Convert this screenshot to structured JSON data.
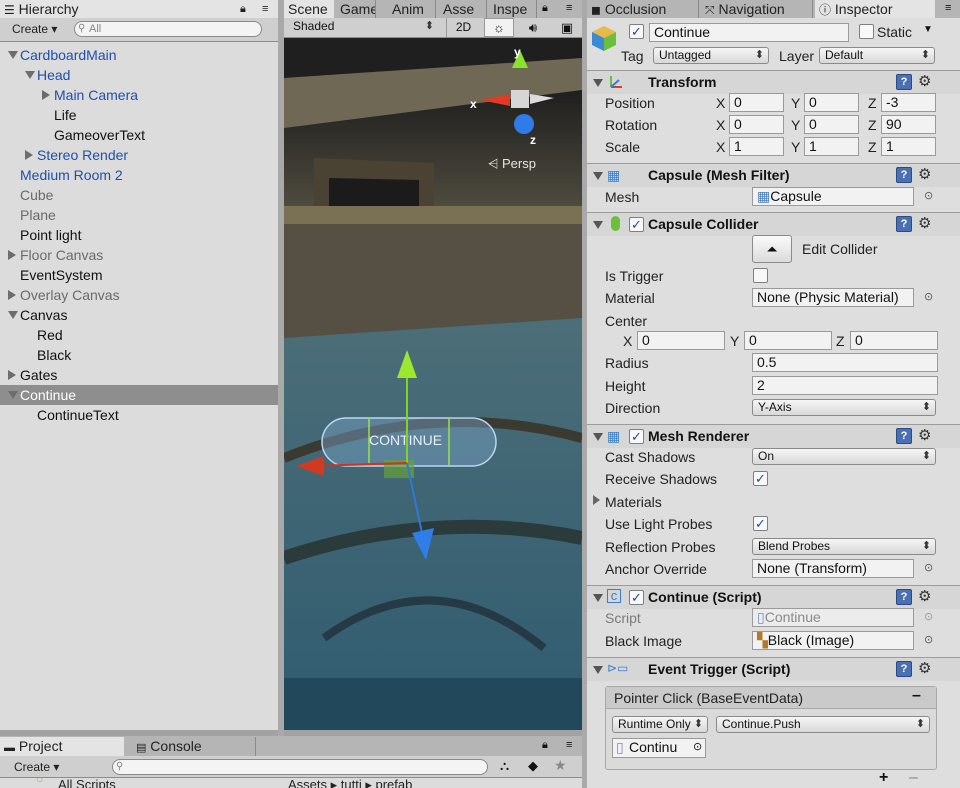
{
  "hierarchy": {
    "tab_label": "Hierarchy",
    "create_label": "Create ▾",
    "search_placeholder": "All",
    "items": [
      {
        "label": "CardboardMain",
        "indent": 0,
        "arrow": "down",
        "color": "blue"
      },
      {
        "label": "Head",
        "indent": 1,
        "arrow": "down",
        "color": "blue"
      },
      {
        "label": "Main Camera",
        "indent": 2,
        "arrow": "right",
        "color": "blue"
      },
      {
        "label": "Life",
        "indent": 2,
        "arrow": "none",
        "color": "black"
      },
      {
        "label": "GameoverText",
        "indent": 2,
        "arrow": "none",
        "color": "black"
      },
      {
        "label": "Stereo Render",
        "indent": 1,
        "arrow": "right",
        "color": "blue"
      },
      {
        "label": "Medium Room 2",
        "indent": 0,
        "arrow": "none",
        "color": "blue"
      },
      {
        "label": "Cube",
        "indent": 0,
        "arrow": "none",
        "color": "gray"
      },
      {
        "label": "Plane",
        "indent": 0,
        "arrow": "none",
        "color": "gray"
      },
      {
        "label": "Point light",
        "indent": 0,
        "arrow": "none",
        "color": "black"
      },
      {
        "label": "Floor Canvas",
        "indent": 0,
        "arrow": "right",
        "color": "gray"
      },
      {
        "label": "EventSystem",
        "indent": 0,
        "arrow": "none",
        "color": "black"
      },
      {
        "label": "Overlay Canvas",
        "indent": 0,
        "arrow": "right",
        "color": "gray"
      },
      {
        "label": "Canvas",
        "indent": 0,
        "arrow": "down",
        "color": "black"
      },
      {
        "label": "Red",
        "indent": 1,
        "arrow": "none",
        "color": "black"
      },
      {
        "label": "Black",
        "indent": 1,
        "arrow": "none",
        "color": "black"
      },
      {
        "label": "Gates",
        "indent": 0,
        "arrow": "right",
        "color": "black"
      },
      {
        "label": "Continue",
        "indent": 0,
        "arrow": "down",
        "color": "white",
        "selected": true
      },
      {
        "label": "ContinueText",
        "indent": 1,
        "arrow": "none",
        "color": "black"
      }
    ]
  },
  "center_tabs": [
    "Scene",
    "Game",
    "Anim",
    "Asse",
    "Inspe"
  ],
  "scene_toolbar": {
    "shading_mode": "Shaded",
    "mode_2d": "2D"
  },
  "scene": {
    "gizmo_labels": {
      "y": "y",
      "x": "x",
      "z": "z"
    },
    "persp_label": "Persp",
    "object_text": "CONTINUE"
  },
  "right_tabs": [
    "Occlusion",
    "Navigation",
    "Inspector"
  ],
  "inspector": {
    "object_name": "Continue",
    "static_label": "Static",
    "tag_label": "Tag",
    "tag_value": "Untagged",
    "layer_label": "Layer",
    "layer_value": "Default",
    "transform": {
      "title": "Transform",
      "position_label": "Position",
      "rotation_label": "Rotation",
      "scale_label": "Scale",
      "position": [
        "0",
        "0",
        "-3"
      ],
      "rotation": [
        "0",
        "0",
        "90"
      ],
      "scale": [
        "1",
        "1",
        "1"
      ],
      "axis_labels": [
        "X",
        "Y",
        "Z"
      ]
    },
    "mesh_filter": {
      "title": "Capsule (Mesh Filter)",
      "mesh_label": "Mesh",
      "mesh_value": "Capsule"
    },
    "capsule_collider": {
      "title": "Capsule Collider",
      "edit_label": "Edit Collider",
      "is_trigger_label": "Is Trigger",
      "material_label": "Material",
      "material_value": "None (Physic Material)",
      "center_label": "Center",
      "center": [
        "0",
        "0",
        "0"
      ],
      "radius_label": "Radius",
      "radius_value": "0.5",
      "height_label": "Height",
      "height_value": "2",
      "direction_label": "Direction",
      "direction_value": "Y-Axis"
    },
    "mesh_renderer": {
      "title": "Mesh Renderer",
      "cast_shadows_label": "Cast Shadows",
      "cast_shadows_value": "On",
      "receive_shadows_label": "Receive Shadows",
      "materials_label": "Materials",
      "use_light_probes_label": "Use Light Probes",
      "reflection_probes_label": "Reflection Probes",
      "reflection_probes_value": "Blend Probes",
      "anchor_override_label": "Anchor Override",
      "anchor_override_value": "None (Transform)"
    },
    "continue_script": {
      "title": "Continue (Script)",
      "script_label": "Script",
      "script_value": "Continue",
      "black_image_label": "Black Image",
      "black_image_value": "Black (Image)"
    },
    "event_trigger": {
      "title": "Event Trigger (Script)",
      "event_label": "Pointer Click (BaseEventData)",
      "runtime_value": "Runtime Only",
      "function_value": "Continue.Push",
      "target_value": "Continu",
      "add_symbol": "+",
      "remove_symbol": "–",
      "minus_symbol": "–"
    }
  },
  "bottom": {
    "tabs": [
      "Project",
      "Console"
    ],
    "create_label": "Create ▾",
    "folder_label": "All Scripts",
    "breadcrumb": "Assets ▸ tutti ▸ prefab"
  },
  "colors": {
    "selected_row": "#8e8e8e",
    "accent_blue": "#1f4fa8"
  }
}
